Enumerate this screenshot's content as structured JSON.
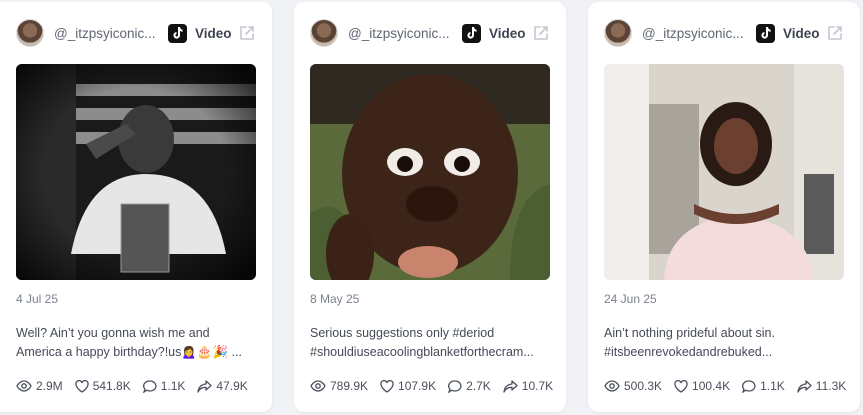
{
  "colors": {
    "background": "#f1f2f6",
    "card": "#ffffff",
    "text": "#444a57",
    "muted": "#7a8090"
  },
  "cards": [
    {
      "handle": "@_itzpsyiconic...",
      "platform": "Video",
      "platform_icon": "tiktok-icon",
      "date": "4 Jul 25",
      "caption_line1": "Well? Ain’t you gonna wish me and",
      "caption_line2": "America a happy birthday?!us🙍‍♀️🎂🎉 ...",
      "views": "2.9M",
      "likes": "541.8K",
      "comments": "1.1K",
      "shares": "47.9K"
    },
    {
      "handle": "@_itzpsyiconic...",
      "platform": "Video",
      "platform_icon": "tiktok-icon",
      "date": "8 May 25",
      "caption_line1": "Serious suggestions only #deriod",
      "caption_line2": "#shouldiuseacoolingblanketforthecram...",
      "views": "789.9K",
      "likes": "107.9K",
      "comments": "2.7K",
      "shares": "10.7K"
    },
    {
      "handle": "@_itzpsyiconic...",
      "platform": "Video",
      "platform_icon": "tiktok-icon",
      "date": "24 Jun 25",
      "caption_line1": "Ain’t nothing prideful about sin.",
      "caption_line2": "#itsbeenrevokedandrebuked...",
      "views": "500.3K",
      "likes": "100.4K",
      "comments": "1.1K",
      "shares": "11.3K"
    }
  ]
}
